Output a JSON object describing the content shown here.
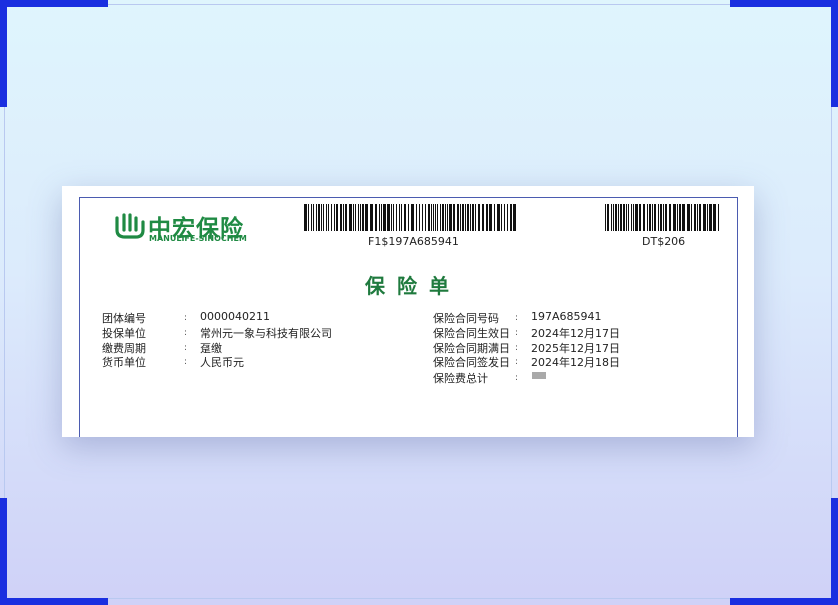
{
  "logo": {
    "cn": "中宏保险",
    "en": "MANULIFE-SINOCHEM"
  },
  "barcodes": [
    {
      "text": "F1$197A685941"
    },
    {
      "text": "DT$206"
    }
  ],
  "title": "保险单",
  "left_fields": [
    {
      "label": "团体编号",
      "value": "0000040211"
    },
    {
      "label": "投保单位",
      "value": "常州元一象与科技有限公司"
    },
    {
      "label": "缴费周期",
      "value": "趸缴"
    },
    {
      "label": "货币单位",
      "value": "人民币元"
    }
  ],
  "right_fields": [
    {
      "label": "保险合同号码",
      "value": "197A685941"
    },
    {
      "label": "保险合同生效日",
      "value": "2024年12月17日"
    },
    {
      "label": "保险合同期满日",
      "value": "2025年12月17日"
    },
    {
      "label": "保险合同签发日",
      "value": "2024年12月18日"
    },
    {
      "label": "保险费总计",
      "value": ""
    }
  ],
  "colors": {
    "brand_green": "#1f8a43",
    "frame_blue": "#1a2fe0",
    "doc_border": "#4b5bb0"
  }
}
